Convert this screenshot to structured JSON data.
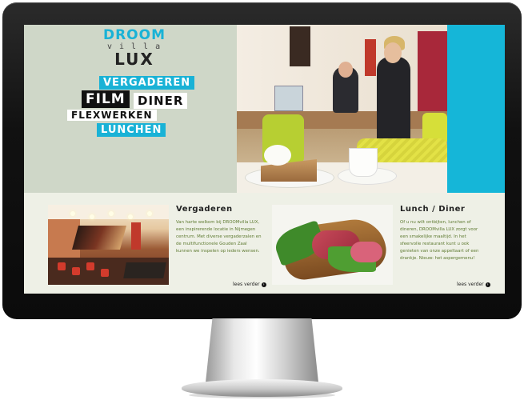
{
  "logo": {
    "line1": "DROOM",
    "line2": "villa",
    "line3": "LUX"
  },
  "tags": {
    "vergaderen": "VERGADEREN",
    "film": "FILM",
    "diner": "DINER",
    "flexwerken": "FLEXWERKEN",
    "lunchen": "LUNCHEN"
  },
  "columns": [
    {
      "title": "Vergaderen",
      "text": "Van harte welkom bij DROOMvilla LUX, een inspirerende locatie in Nijmegen centrum. Met diverse vergaderzalen en de multifunctionele Gouden Zaal kunnen we inspelen op ieders wensen.",
      "more": "lees verder"
    },
    {
      "title": "Lunch / Diner",
      "text": "Of u nu wilt ontbijten, lunchen of dineren, DROOMvilla LUX zorgt voor een smakelijke maaltijd. In het sfeervolle restaurant kunt u ook genieten van onze appeltaart of een drankje. Nieuw: het aspergemenu!",
      "more": "lees verder"
    }
  ],
  "colors": {
    "accent": "#15b6d8",
    "text_green": "#5e7a31",
    "hero_left": "#cfd7c8"
  },
  "icons": {
    "more": "arrow-circle-right-icon"
  }
}
